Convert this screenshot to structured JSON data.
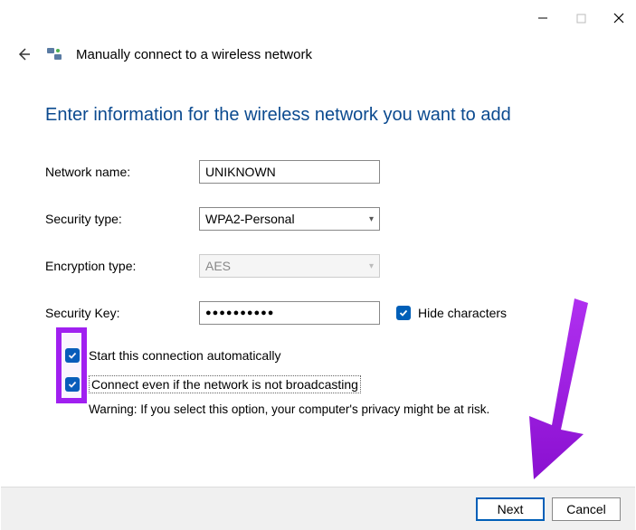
{
  "window": {
    "title": "Manually connect to a wireless network"
  },
  "page": {
    "heading": "Enter information for the wireless network you want to add"
  },
  "form": {
    "network_name_label": "Network name:",
    "network_name_value": "UNIKNOWN",
    "security_type_label": "Security type:",
    "security_type_value": "WPA2-Personal",
    "encryption_type_label": "Encryption type:",
    "encryption_type_value": "AES",
    "security_key_label": "Security Key:",
    "security_key_value": "●●●●●●●●●●",
    "hide_characters_label": "Hide characters",
    "start_auto_label": "Start this connection automatically",
    "connect_hidden_label": "Connect even if the network is not broadcasting",
    "warning_text": "Warning: If you select this option, your computer's privacy might be at risk."
  },
  "footer": {
    "next": "Next",
    "cancel": "Cancel"
  },
  "colors": {
    "accent": "#005fb8",
    "heading": "#0b4a8f",
    "highlight": "#a020f0"
  }
}
